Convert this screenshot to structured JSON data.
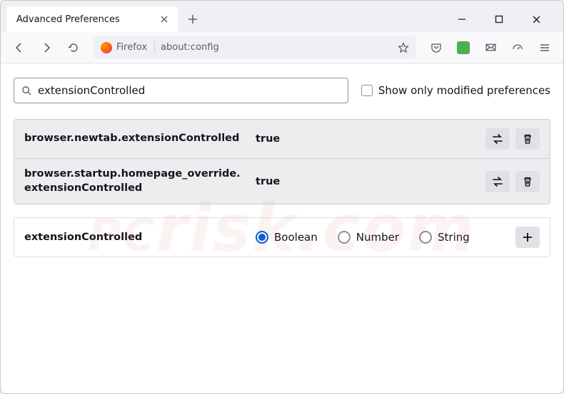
{
  "window": {
    "tab_title": "Advanced Preferences"
  },
  "toolbar": {
    "identity_label": "Firefox",
    "url": "about:config"
  },
  "search": {
    "value": "extensionControlled",
    "checkbox_label": "Show only modified preferences"
  },
  "prefs": [
    {
      "name": "browser.newtab.extensionControlled",
      "value": "true"
    },
    {
      "name": "browser.startup.homepage_override.extensionControlled",
      "value": "true"
    }
  ],
  "new_pref": {
    "name": "extensionControlled",
    "types": [
      "Boolean",
      "Number",
      "String"
    ],
    "selected": "Boolean"
  },
  "watermark": {
    "pc": "PC",
    "rest": "risk.com"
  }
}
